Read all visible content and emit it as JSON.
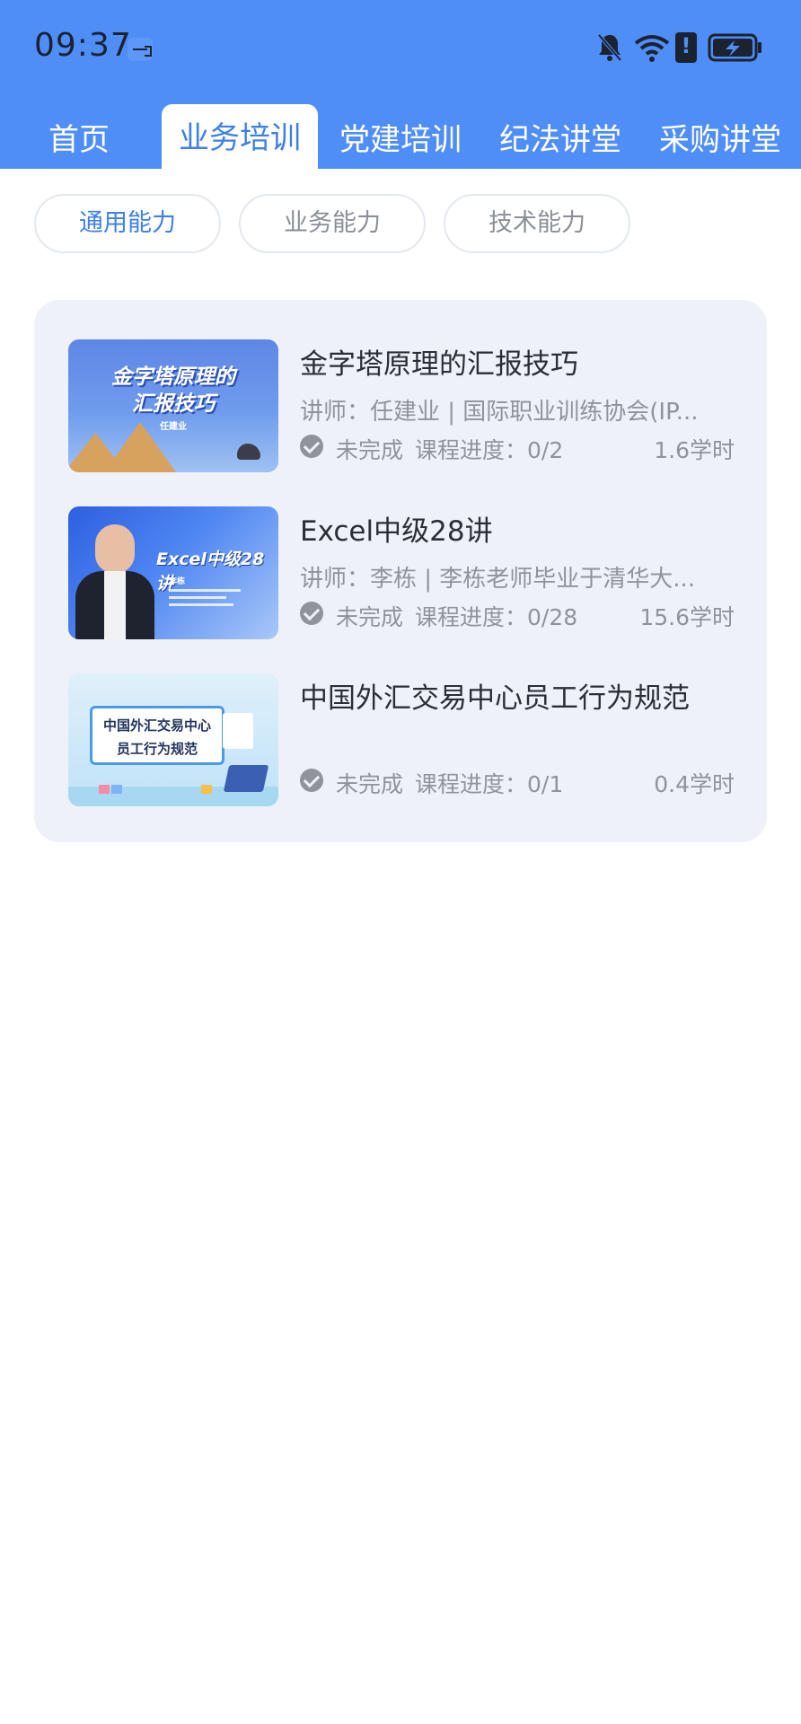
{
  "status_bar": {
    "time": "09:37",
    "icons": [
      "usb-icon",
      "bell-off-icon",
      "wifi-icon",
      "alert-icon",
      "battery-charging-icon"
    ]
  },
  "tabs": [
    {
      "label": "首页",
      "active": false
    },
    {
      "label": "业务培训",
      "active": true
    },
    {
      "label": "党建培训",
      "active": false
    },
    {
      "label": "纪法讲堂",
      "active": false
    },
    {
      "label": "采购讲堂",
      "active": false
    }
  ],
  "filters": [
    {
      "label": "通用能力",
      "active": true
    },
    {
      "label": "业务能力",
      "active": false
    },
    {
      "label": "技术能力",
      "active": false
    }
  ],
  "courses": [
    {
      "title": "金字塔原理的汇报技巧",
      "lecturer": "讲师：任建业 | 国际职业训练协会(IP...",
      "status": "未完成",
      "progress": "课程进度：0/2",
      "hours": "1.6学时",
      "thumb": {
        "title_lines": [
          "金字塔原理的",
          "汇报技巧"
        ],
        "name": "任建业"
      }
    },
    {
      "title": "Excel中级28讲",
      "lecturer": "讲师：李栋 | 李栋老师毕业于清华大...",
      "status": "未完成",
      "progress": "课程进度：0/28",
      "hours": "15.6学时",
      "thumb": {
        "title_lines": [
          "Excel中级28讲"
        ],
        "name": "李栋"
      }
    },
    {
      "title": "中国外汇交易中心员工行为规范",
      "lecturer": "",
      "status": "未完成",
      "progress": "课程进度：0/1",
      "hours": "0.4学时",
      "thumb": {
        "title_lines": [
          "中国外汇交易中心",
          "员工行为规范"
        ]
      }
    }
  ],
  "colors": {
    "brand_blue": "#4f8ef7",
    "active_text": "#3f7fe8",
    "card_bg": "#eef2f8",
    "muted_text": "#8f939a"
  }
}
